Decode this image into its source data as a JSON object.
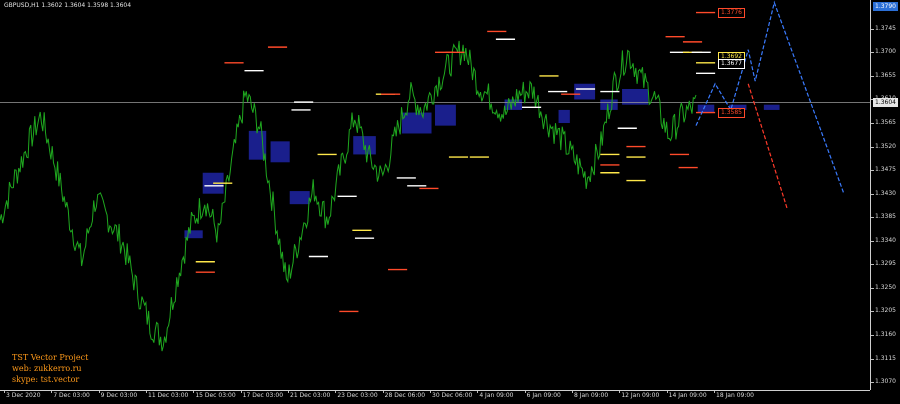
{
  "header": {
    "symbol_info": "GBPUSD,H1  1.3602 1.3604 1.3598 1.3604"
  },
  "price_axis": {
    "current_price": "1.3604",
    "top_label": "1.3790",
    "ticks": [
      "1.3745",
      "1.3700",
      "1.3655",
      "1.3610",
      "1.3565",
      "1.3520",
      "1.3475",
      "1.3430",
      "1.3385",
      "1.3340",
      "1.3295",
      "1.3250",
      "1.3205",
      "1.3160",
      "1.3115",
      "1.3070"
    ]
  },
  "time_axis": {
    "ticks": [
      "3 Dec 2020",
      "7 Dec 03:00",
      "9 Dec 03:00",
      "11 Dec 03:00",
      "15 Dec 03:00",
      "17 Dec 03:00",
      "21 Dec 03:00",
      "23 Dec 03:00",
      "28 Dec 06:00",
      "30 Dec 06:00",
      "4 Jan 09:00",
      "6 Jan 09:00",
      "8 Jan 09:00",
      "12 Jan 09:00",
      "14 Jan 09:00",
      "18 Jan 09:00"
    ]
  },
  "level_tags": [
    {
      "text": "1.3776",
      "color": "#ff4a2a"
    },
    {
      "text": "1.3692",
      "color": "#ffe84a"
    },
    {
      "text": "1.3677",
      "color": "#ffffff"
    },
    {
      "text": "1.3585",
      "color": "#ff4a2a"
    }
  ],
  "credits": {
    "line1": "TST Vector Project",
    "line2": "web: zukkerro.ru",
    "line3": "skype: tst.vector"
  },
  "colors": {
    "background": "#000000",
    "price_line": "#1fa81f",
    "zone": "#1a1f8c",
    "level_red": "#ff4a2a",
    "level_white": "#ffffff",
    "level_yellow": "#ffe84a",
    "forecast_blue": "#3a7bff",
    "forecast_red": "#ff3a2a",
    "credits": "#ff9a1a"
  },
  "chart_data": {
    "type": "line",
    "title": "",
    "series": [
      {
        "values": [
          1.338,
          1.3455,
          1.352,
          1.358,
          1.349,
          1.339,
          1.33,
          1.342,
          1.338,
          1.3335,
          1.325,
          1.318,
          1.315,
          1.327,
          1.337,
          1.342,
          1.335,
          1.349,
          1.362,
          1.356,
          1.341,
          1.326,
          1.335,
          1.344,
          1.338,
          1.348,
          1.358,
          1.35,
          1.346,
          1.354,
          1.362,
          1.359,
          1.364,
          1.368,
          1.371,
          1.364,
          1.361,
          1.358,
          1.362,
          1.363,
          1.357,
          1.354,
          1.35,
          1.346,
          1.352,
          1.364,
          1.37,
          1.365,
          1.361,
          1.354,
          1.358,
          1.36
        ]
      }
    ],
    "forecast_blue": [
      1.356,
      1.364,
      1.359,
      1.3705,
      1.3645,
      1.3795,
      1.343
    ],
    "forecast_red": [
      1.364,
      1.34
    ],
    "zones": [
      {
        "x0": 0.233,
        "x1": 0.257,
        "y0": 1.347,
        "y1": 1.343
      },
      {
        "x0": 0.286,
        "x1": 0.306,
        "y0": 1.355,
        "y1": 1.3495
      },
      {
        "x0": 0.311,
        "x1": 0.333,
        "y0": 1.353,
        "y1": 1.349
      },
      {
        "x0": 0.333,
        "x1": 0.356,
        "y0": 1.3435,
        "y1": 1.341
      },
      {
        "x0": 0.212,
        "x1": 0.233,
        "y0": 1.336,
        "y1": 1.3345
      },
      {
        "x0": 0.462,
        "x1": 0.496,
        "y0": 1.3585,
        "y1": 1.3545
      },
      {
        "x0": 0.5,
        "x1": 0.524,
        "y0": 1.36,
        "y1": 1.356
      },
      {
        "x0": 0.406,
        "x1": 0.432,
        "y0": 1.354,
        "y1": 1.3505
      },
      {
        "x0": 0.58,
        "x1": 0.6,
        "y0": 1.361,
        "y1": 1.359
      },
      {
        "x0": 0.66,
        "x1": 0.684,
        "y0": 1.364,
        "y1": 1.361
      },
      {
        "x0": 0.642,
        "x1": 0.655,
        "y0": 1.359,
        "y1": 1.3565
      },
      {
        "x0": 0.69,
        "x1": 0.71,
        "y0": 1.361,
        "y1": 1.359
      },
      {
        "x0": 0.715,
        "x1": 0.745,
        "y0": 1.363,
        "y1": 1.36
      },
      {
        "x0": 0.802,
        "x1": 0.821,
        "y0": 1.36,
        "y1": 1.3585
      },
      {
        "x0": 0.838,
        "x1": 0.858,
        "y0": 1.36,
        "y1": 1.359
      },
      {
        "x0": 0.878,
        "x1": 0.896,
        "y0": 1.36,
        "y1": 1.359
      }
    ],
    "levels": [
      {
        "x0": 0.225,
        "x1": 0.247,
        "y": 1.33,
        "color": "#ffe84a"
      },
      {
        "x0": 0.225,
        "x1": 0.247,
        "y": 1.328,
        "color": "#ff4a2a"
      },
      {
        "x0": 0.235,
        "x1": 0.257,
        "y": 1.3445,
        "color": "#ffffff"
      },
      {
        "x0": 0.245,
        "x1": 0.267,
        "y": 1.345,
        "color": "#ffe84a"
      },
      {
        "x0": 0.258,
        "x1": 0.28,
        "y": 1.368,
        "color": "#ff4a2a"
      },
      {
        "x0": 0.281,
        "x1": 0.303,
        "y": 1.3665,
        "color": "#ffffff"
      },
      {
        "x0": 0.308,
        "x1": 0.33,
        "y": 1.371,
        "color": "#ff4a2a"
      },
      {
        "x0": 0.335,
        "x1": 0.357,
        "y": 1.359,
        "color": "#ffffff"
      },
      {
        "x0": 0.338,
        "x1": 0.36,
        "y": 1.3605,
        "color": "#ffffff"
      },
      {
        "x0": 0.365,
        "x1": 0.387,
        "y": 1.3505,
        "color": "#ffe84a"
      },
      {
        "x0": 0.355,
        "x1": 0.377,
        "y": 1.331,
        "color": "#ffffff"
      },
      {
        "x0": 0.388,
        "x1": 0.41,
        "y": 1.3425,
        "color": "#ffffff"
      },
      {
        "x0": 0.39,
        "x1": 0.412,
        "y": 1.3205,
        "color": "#ff4a2a"
      },
      {
        "x0": 0.405,
        "x1": 0.427,
        "y": 1.336,
        "color": "#ffe84a"
      },
      {
        "x0": 0.408,
        "x1": 0.43,
        "y": 1.3345,
        "color": "#ffffff"
      },
      {
        "x0": 0.432,
        "x1": 0.454,
        "y": 1.362,
        "color": "#ffe84a"
      },
      {
        "x0": 0.438,
        "x1": 0.46,
        "y": 1.362,
        "color": "#ff4a2a"
      },
      {
        "x0": 0.446,
        "x1": 0.468,
        "y": 1.3285,
        "color": "#ff4a2a"
      },
      {
        "x0": 0.456,
        "x1": 0.478,
        "y": 1.346,
        "color": "#ffffff"
      },
      {
        "x0": 0.468,
        "x1": 0.49,
        "y": 1.3445,
        "color": "#ffffff"
      },
      {
        "x0": 0.482,
        "x1": 0.504,
        "y": 1.344,
        "color": "#ff4a2a"
      },
      {
        "x0": 0.5,
        "x1": 0.522,
        "y": 1.37,
        "color": "#ff4a2a"
      },
      {
        "x0": 0.512,
        "x1": 0.534,
        "y": 1.37,
        "color": "#ff4a2a"
      },
      {
        "x0": 0.516,
        "x1": 0.538,
        "y": 1.35,
        "color": "#ffe84a"
      },
      {
        "x0": 0.54,
        "x1": 0.562,
        "y": 1.35,
        "color": "#ffe84a"
      },
      {
        "x0": 0.56,
        "x1": 0.582,
        "y": 1.374,
        "color": "#ff4a2a"
      },
      {
        "x0": 0.57,
        "x1": 0.592,
        "y": 1.3725,
        "color": "#ffffff"
      },
      {
        "x0": 0.6,
        "x1": 0.622,
        "y": 1.3595,
        "color": "#ffffff"
      },
      {
        "x0": 0.62,
        "x1": 0.642,
        "y": 1.3655,
        "color": "#ffe84a"
      },
      {
        "x0": 0.63,
        "x1": 0.652,
        "y": 1.3625,
        "color": "#ffffff"
      },
      {
        "x0": 0.645,
        "x1": 0.667,
        "y": 1.362,
        "color": "#ff4a2a"
      },
      {
        "x0": 0.662,
        "x1": 0.684,
        "y": 1.363,
        "color": "#ffffff"
      },
      {
        "x0": 0.69,
        "x1": 0.712,
        "y": 1.3625,
        "color": "#ffffff"
      },
      {
        "x0": 0.71,
        "x1": 0.732,
        "y": 1.3555,
        "color": "#ffffff"
      },
      {
        "x0": 0.69,
        "x1": 0.712,
        "y": 1.3505,
        "color": "#ffe84a"
      },
      {
        "x0": 0.69,
        "x1": 0.712,
        "y": 1.3485,
        "color": "#ff4a2a"
      },
      {
        "x0": 0.69,
        "x1": 0.712,
        "y": 1.347,
        "color": "#ffe84a"
      },
      {
        "x0": 0.72,
        "x1": 0.742,
        "y": 1.3455,
        "color": "#ffe84a"
      },
      {
        "x0": 0.72,
        "x1": 0.742,
        "y": 1.352,
        "color": "#ff4a2a"
      },
      {
        "x0": 0.72,
        "x1": 0.742,
        "y": 1.35,
        "color": "#ffe84a"
      },
      {
        "x0": 0.765,
        "x1": 0.787,
        "y": 1.373,
        "color": "#ff4a2a"
      },
      {
        "x0": 0.77,
        "x1": 0.792,
        "y": 1.37,
        "color": "#ffffff"
      },
      {
        "x0": 0.77,
        "x1": 0.792,
        "y": 1.3505,
        "color": "#ff4a2a"
      },
      {
        "x0": 0.785,
        "x1": 0.807,
        "y": 1.372,
        "color": "#ff4a2a"
      },
      {
        "x0": 0.785,
        "x1": 0.807,
        "y": 1.37,
        "color": "#ffe84a"
      },
      {
        "x0": 0.78,
        "x1": 0.802,
        "y": 1.348,
        "color": "#ff4a2a"
      },
      {
        "x0": 0.795,
        "x1": 0.817,
        "y": 1.37,
        "color": "#ffffff"
      },
      {
        "x0": 0.8,
        "x1": 0.822,
        "y": 1.368,
        "color": "#ffe84a"
      },
      {
        "x0": 0.8,
        "x1": 0.822,
        "y": 1.366,
        "color": "#ffffff"
      },
      {
        "x0": 0.8,
        "x1": 0.822,
        "y": 1.3585,
        "color": "#ff4a2a"
      },
      {
        "x0": 0.8,
        "x1": 0.822,
        "y": 1.3776,
        "color": "#ff4a2a"
      }
    ],
    "ylim": [
      1.3055,
      1.38
    ]
  }
}
